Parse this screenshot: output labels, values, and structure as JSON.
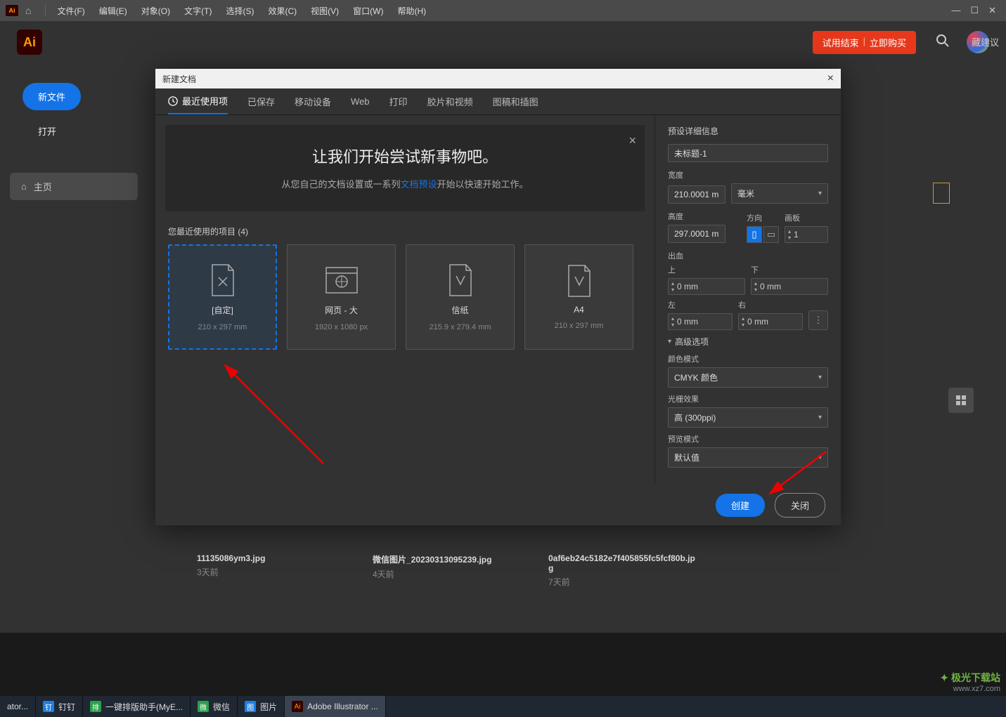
{
  "menubar": {
    "items": [
      "文件(F)",
      "编辑(E)",
      "对象(O)",
      "文字(T)",
      "选择(S)",
      "效果(C)",
      "视图(V)",
      "窗口(W)",
      "帮助(H)"
    ]
  },
  "header": {
    "trial_end": "试用结束",
    "buy_now": "立即购买"
  },
  "sidebar": {
    "new_file": "新文件",
    "open": "打开",
    "home": "主页"
  },
  "suggest": "藏建议",
  "dialog": {
    "title": "新建文档",
    "tabs": [
      "最近使用项",
      "已保存",
      "移动设备",
      "Web",
      "打印",
      "胶片和视频",
      "图稿和插图"
    ],
    "banner": {
      "headline": "让我们开始尝试新事物吧。",
      "sub_pre": "从您自己的文档设置或一系列",
      "sub_link": "文档预设",
      "sub_post": "开始以快速开始工作。"
    },
    "recent_label": "您最近使用的项目 (4)",
    "presets": [
      {
        "title": "[自定]",
        "size": "210 x 297 mm"
      },
      {
        "title": "网页 - 大",
        "size": "1920 x 1080 px"
      },
      {
        "title": "信纸",
        "size": "215.9 x 279.4 mm"
      },
      {
        "title": "A4",
        "size": "210 x 297 mm"
      }
    ],
    "details": {
      "header": "预设详细信息",
      "name": "未标题-1",
      "width_label": "宽度",
      "width": "210.0001 m",
      "unit": "毫米",
      "height_label": "高度",
      "height": "297.0001 m",
      "orient_label": "方向",
      "artboard_label": "画板",
      "artboards": "1",
      "bleed_label": "出血",
      "top": "上",
      "bottom": "下",
      "left": "左",
      "right": "右",
      "bleed_val": "0 mm",
      "advanced": "高级选项",
      "colormode_label": "颜色模式",
      "colormode": "CMYK 颜色",
      "raster_label": "光栅效果",
      "raster": "高 (300ppi)",
      "preview_label": "预览模式",
      "preview": "默认值"
    },
    "create": "创建",
    "close": "关闭"
  },
  "recent_files": [
    {
      "name": "11135086ym3.jpg",
      "time": "3天前"
    },
    {
      "name": "微信图片_20230313095239.jpg",
      "time": "4天前"
    },
    {
      "name": "0af6eb24c5182e7f405855fc5fcf80b.jpg",
      "time": "7天前"
    }
  ],
  "taskbar": {
    "items": [
      {
        "label": "ator...",
        "color": "#333"
      },
      {
        "label": "钉钉",
        "color": "#1e7fe0"
      },
      {
        "label": "一键排版助手(MyE...",
        "color": "#2aa04a"
      },
      {
        "label": "微信",
        "color": "#2aa04a"
      },
      {
        "label": "图片",
        "color": "#1e7fe0"
      },
      {
        "label": "Adobe Illustrator ...",
        "color": "#ff9a00"
      }
    ]
  },
  "watermark": {
    "brand": "极光下载站",
    "url": "www.xz7.com"
  }
}
